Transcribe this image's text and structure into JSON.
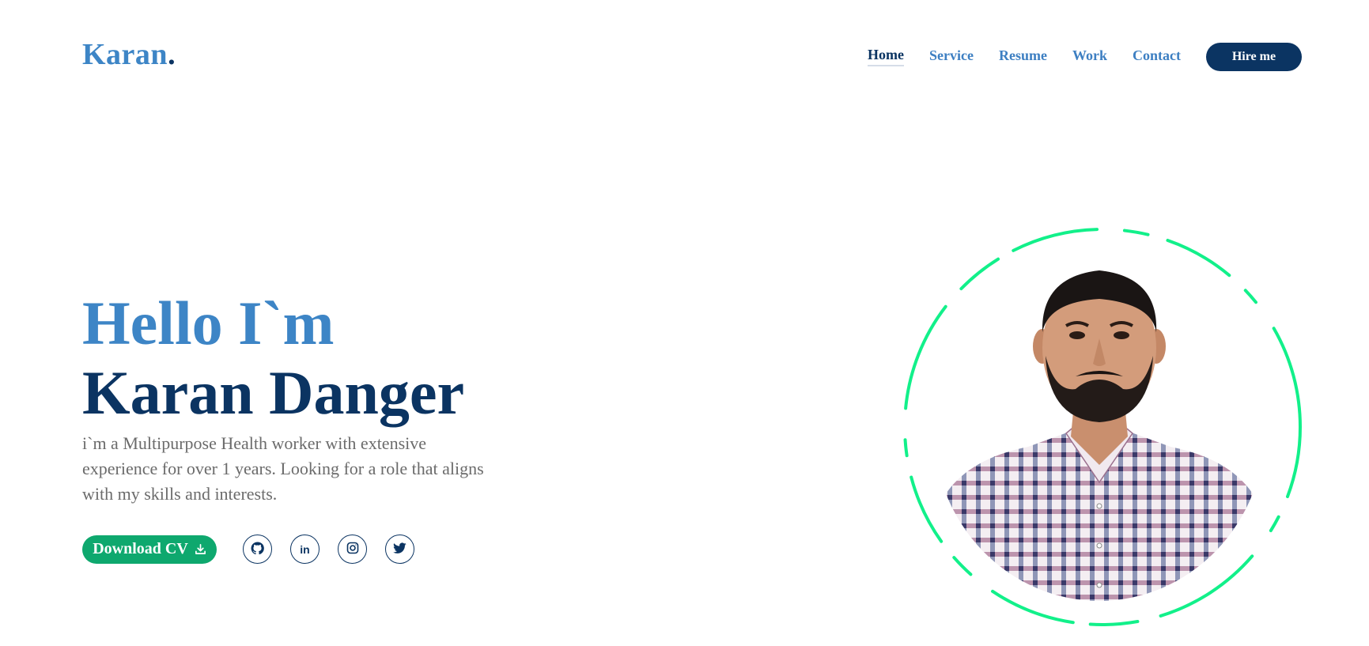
{
  "header": {
    "logo_text": "Karan",
    "logo_dot": ".",
    "nav": [
      {
        "label": "Home",
        "active": true
      },
      {
        "label": "Service"
      },
      {
        "label": "Resume"
      },
      {
        "label": "Work"
      },
      {
        "label": "Contact"
      }
    ],
    "hire_label": "Hire me"
  },
  "hero": {
    "greeting": "Hello I`m",
    "name": "Karan Danger",
    "description": "i`m a Multipurpose Health worker with extensive experience for over 1 years. Looking for a role that aligns with my skills and interests.",
    "cv_label": "Download CV",
    "socials": [
      {
        "icon": "github-icon"
      },
      {
        "icon": "linkedin-icon",
        "glyph": "in"
      },
      {
        "icon": "instagram-icon"
      },
      {
        "icon": "twitter-icon"
      }
    ]
  },
  "colors": {
    "brand_light": "#3d85c6",
    "brand_dark": "#0b3462",
    "accent_green": "#0ea86e",
    "ring_green": "#12f08a"
  }
}
